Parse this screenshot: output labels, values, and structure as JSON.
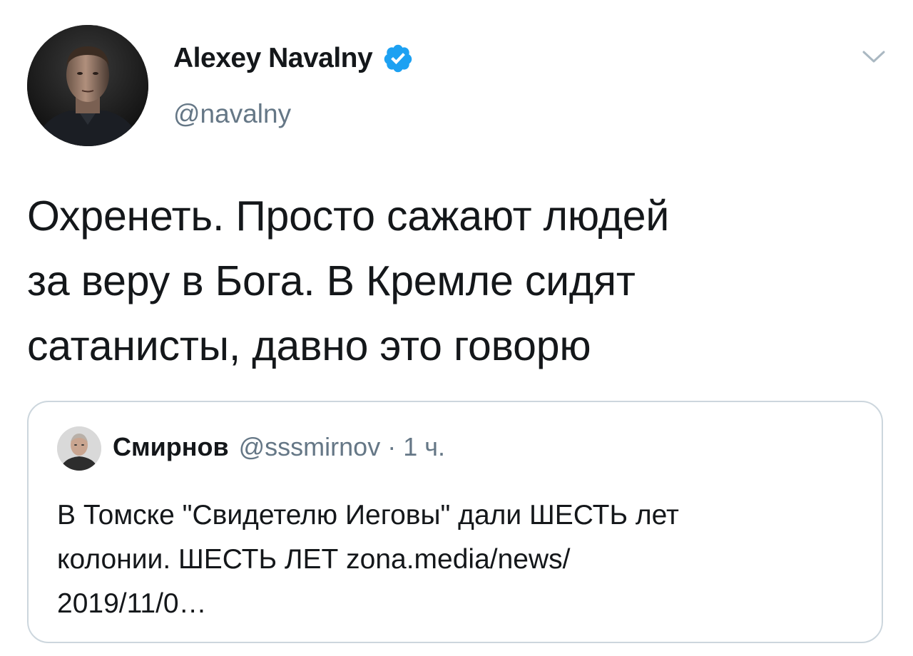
{
  "author": {
    "name": "Alexey Navalny",
    "handle": "@navalny",
    "verified": true,
    "avatar_icon": "profile-photo-avatar"
  },
  "tweet": {
    "text_lines": [
      "Охренеть. Просто сажают людей",
      "за веру в Бога. В Кремле сидят",
      "сатанисты, давно это говорю"
    ]
  },
  "quoted_tweet": {
    "author_name": "Смирнов",
    "handle": "@sssmirnov",
    "separator": "·",
    "time": "1 ч.",
    "text_lines": [
      "В Томске \"Свидетелю Иеговы\" дали ШЕСТЬ лет",
      "колонии. ШЕСТЬ ЛЕТ zona.media/news/",
      "2019/11/0…"
    ]
  },
  "icons": {
    "verified": "verified-badge-icon",
    "menu": "chevron-down-icon"
  },
  "colors": {
    "text_primary": "#14171a",
    "text_secondary": "#657786",
    "verified_blue": "#1da1f2",
    "border": "#ccd6dd"
  }
}
